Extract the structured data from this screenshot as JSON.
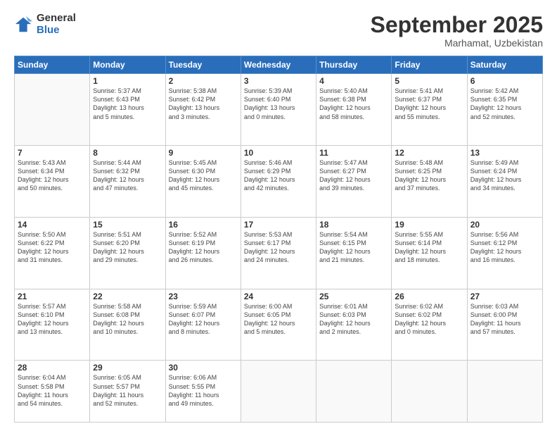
{
  "logo": {
    "general": "General",
    "blue": "Blue"
  },
  "header": {
    "month": "September 2025",
    "location": "Marhamat, Uzbekistan"
  },
  "weekdays": [
    "Sunday",
    "Monday",
    "Tuesday",
    "Wednesday",
    "Thursday",
    "Friday",
    "Saturday"
  ],
  "weeks": [
    [
      {
        "day": "",
        "info": ""
      },
      {
        "day": "1",
        "info": "Sunrise: 5:37 AM\nSunset: 6:43 PM\nDaylight: 13 hours\nand 5 minutes."
      },
      {
        "day": "2",
        "info": "Sunrise: 5:38 AM\nSunset: 6:42 PM\nDaylight: 13 hours\nand 3 minutes."
      },
      {
        "day": "3",
        "info": "Sunrise: 5:39 AM\nSunset: 6:40 PM\nDaylight: 13 hours\nand 0 minutes."
      },
      {
        "day": "4",
        "info": "Sunrise: 5:40 AM\nSunset: 6:38 PM\nDaylight: 12 hours\nand 58 minutes."
      },
      {
        "day": "5",
        "info": "Sunrise: 5:41 AM\nSunset: 6:37 PM\nDaylight: 12 hours\nand 55 minutes."
      },
      {
        "day": "6",
        "info": "Sunrise: 5:42 AM\nSunset: 6:35 PM\nDaylight: 12 hours\nand 52 minutes."
      }
    ],
    [
      {
        "day": "7",
        "info": "Sunrise: 5:43 AM\nSunset: 6:34 PM\nDaylight: 12 hours\nand 50 minutes."
      },
      {
        "day": "8",
        "info": "Sunrise: 5:44 AM\nSunset: 6:32 PM\nDaylight: 12 hours\nand 47 minutes."
      },
      {
        "day": "9",
        "info": "Sunrise: 5:45 AM\nSunset: 6:30 PM\nDaylight: 12 hours\nand 45 minutes."
      },
      {
        "day": "10",
        "info": "Sunrise: 5:46 AM\nSunset: 6:29 PM\nDaylight: 12 hours\nand 42 minutes."
      },
      {
        "day": "11",
        "info": "Sunrise: 5:47 AM\nSunset: 6:27 PM\nDaylight: 12 hours\nand 39 minutes."
      },
      {
        "day": "12",
        "info": "Sunrise: 5:48 AM\nSunset: 6:25 PM\nDaylight: 12 hours\nand 37 minutes."
      },
      {
        "day": "13",
        "info": "Sunrise: 5:49 AM\nSunset: 6:24 PM\nDaylight: 12 hours\nand 34 minutes."
      }
    ],
    [
      {
        "day": "14",
        "info": "Sunrise: 5:50 AM\nSunset: 6:22 PM\nDaylight: 12 hours\nand 31 minutes."
      },
      {
        "day": "15",
        "info": "Sunrise: 5:51 AM\nSunset: 6:20 PM\nDaylight: 12 hours\nand 29 minutes."
      },
      {
        "day": "16",
        "info": "Sunrise: 5:52 AM\nSunset: 6:19 PM\nDaylight: 12 hours\nand 26 minutes."
      },
      {
        "day": "17",
        "info": "Sunrise: 5:53 AM\nSunset: 6:17 PM\nDaylight: 12 hours\nand 24 minutes."
      },
      {
        "day": "18",
        "info": "Sunrise: 5:54 AM\nSunset: 6:15 PM\nDaylight: 12 hours\nand 21 minutes."
      },
      {
        "day": "19",
        "info": "Sunrise: 5:55 AM\nSunset: 6:14 PM\nDaylight: 12 hours\nand 18 minutes."
      },
      {
        "day": "20",
        "info": "Sunrise: 5:56 AM\nSunset: 6:12 PM\nDaylight: 12 hours\nand 16 minutes."
      }
    ],
    [
      {
        "day": "21",
        "info": "Sunrise: 5:57 AM\nSunset: 6:10 PM\nDaylight: 12 hours\nand 13 minutes."
      },
      {
        "day": "22",
        "info": "Sunrise: 5:58 AM\nSunset: 6:08 PM\nDaylight: 12 hours\nand 10 minutes."
      },
      {
        "day": "23",
        "info": "Sunrise: 5:59 AM\nSunset: 6:07 PM\nDaylight: 12 hours\nand 8 minutes."
      },
      {
        "day": "24",
        "info": "Sunrise: 6:00 AM\nSunset: 6:05 PM\nDaylight: 12 hours\nand 5 minutes."
      },
      {
        "day": "25",
        "info": "Sunrise: 6:01 AM\nSunset: 6:03 PM\nDaylight: 12 hours\nand 2 minutes."
      },
      {
        "day": "26",
        "info": "Sunrise: 6:02 AM\nSunset: 6:02 PM\nDaylight: 12 hours\nand 0 minutes."
      },
      {
        "day": "27",
        "info": "Sunrise: 6:03 AM\nSunset: 6:00 PM\nDaylight: 11 hours\nand 57 minutes."
      }
    ],
    [
      {
        "day": "28",
        "info": "Sunrise: 6:04 AM\nSunset: 5:58 PM\nDaylight: 11 hours\nand 54 minutes."
      },
      {
        "day": "29",
        "info": "Sunrise: 6:05 AM\nSunset: 5:57 PM\nDaylight: 11 hours\nand 52 minutes."
      },
      {
        "day": "30",
        "info": "Sunrise: 6:06 AM\nSunset: 5:55 PM\nDaylight: 11 hours\nand 49 minutes."
      },
      {
        "day": "",
        "info": ""
      },
      {
        "day": "",
        "info": ""
      },
      {
        "day": "",
        "info": ""
      },
      {
        "day": "",
        "info": ""
      }
    ]
  ]
}
